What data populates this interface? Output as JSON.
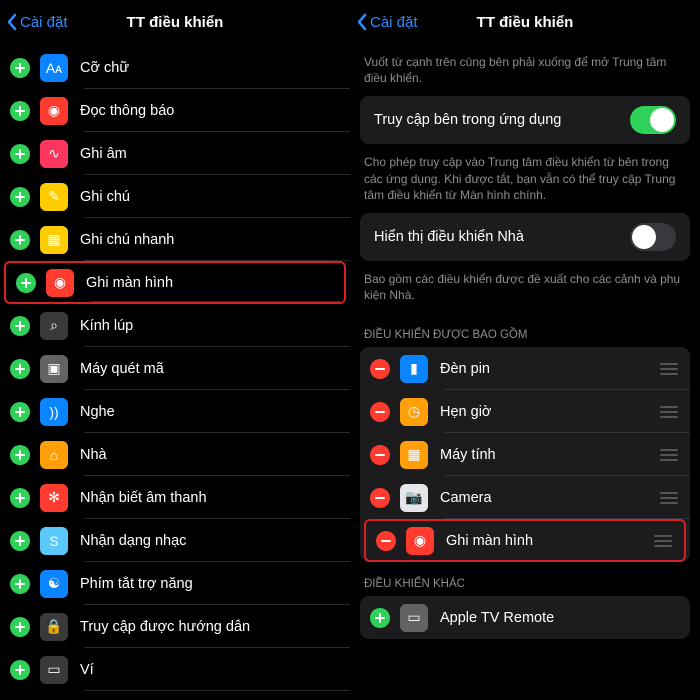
{
  "left": {
    "back": "Cài đặt",
    "title": "TT điều khiển",
    "items": [
      {
        "label": "Cỡ chữ",
        "bg": "ic-blue",
        "glyph": "Aᴀ"
      },
      {
        "label": "Đọc thông báo",
        "bg": "ic-red",
        "glyph": "◉"
      },
      {
        "label": "Ghi âm",
        "bg": "ic-pink",
        "glyph": "∿"
      },
      {
        "label": "Ghi chú",
        "bg": "ic-yellow",
        "glyph": "✎"
      },
      {
        "label": "Ghi chú nhanh",
        "bg": "ic-yellow",
        "glyph": "▦"
      },
      {
        "label": "Ghi màn hình",
        "bg": "ic-red",
        "glyph": "◉",
        "hl": true
      },
      {
        "label": "Kính lúp",
        "bg": "ic-dgray",
        "glyph": "⌕"
      },
      {
        "label": "Máy quét mã",
        "bg": "ic-gray",
        "glyph": "▣"
      },
      {
        "label": "Nghe",
        "bg": "ic-blue",
        "glyph": "))"
      },
      {
        "label": "Nhà",
        "bg": "ic-orange",
        "glyph": "⌂"
      },
      {
        "label": "Nhận biết âm thanh",
        "bg": "ic-red",
        "glyph": "✻"
      },
      {
        "label": "Nhận dạng nhạc",
        "bg": "ic-teal",
        "glyph": "S"
      },
      {
        "label": "Phím tắt trợ năng",
        "bg": "ic-blue",
        "glyph": "☯"
      },
      {
        "label": "Truy cập được hướng dẫn",
        "bg": "ic-dgray",
        "glyph": "🔒"
      },
      {
        "label": "Ví",
        "bg": "ic-dgray",
        "glyph": "▭"
      }
    ]
  },
  "right": {
    "back": "Cài đặt",
    "title": "TT điều khiển",
    "hint1": "Vuốt từ cạnh trên cùng bên phải xuống để mở Trung tâm điều khiển.",
    "toggle1": {
      "label": "Truy cập bên trong ứng dụng",
      "on": true
    },
    "hint2": "Cho phép truy cập vào Trung tâm điều khiển từ bên trong các ứng dụng. Khi được tắt, bạn vẫn có thể truy cập Trung tâm điều khiển từ Màn hình chính.",
    "toggle2": {
      "label": "Hiển thị điều khiển Nhà",
      "on": false
    },
    "hint3": "Bao gồm các điều khiển được đề xuất cho các cảnh và phụ kiện Nhà.",
    "section1": "ĐIỀU KHIỂN ĐƯỢC BAO GỒM",
    "included": [
      {
        "label": "Đèn pin",
        "bg": "ic-blue",
        "glyph": "▮"
      },
      {
        "label": "Hẹn giờ",
        "bg": "ic-orange",
        "glyph": "◷"
      },
      {
        "label": "Máy tính",
        "bg": "ic-orange",
        "glyph": "▦"
      },
      {
        "label": "Camera",
        "bg": "ic-white",
        "glyph": "📷"
      },
      {
        "label": "Ghi màn hình",
        "bg": "ic-red",
        "glyph": "◉",
        "hl": true
      }
    ],
    "section2": "ĐIỀU KHIỂN KHÁC",
    "other": [
      {
        "label": "Apple TV Remote",
        "bg": "ic-gray",
        "glyph": "▭"
      }
    ]
  }
}
